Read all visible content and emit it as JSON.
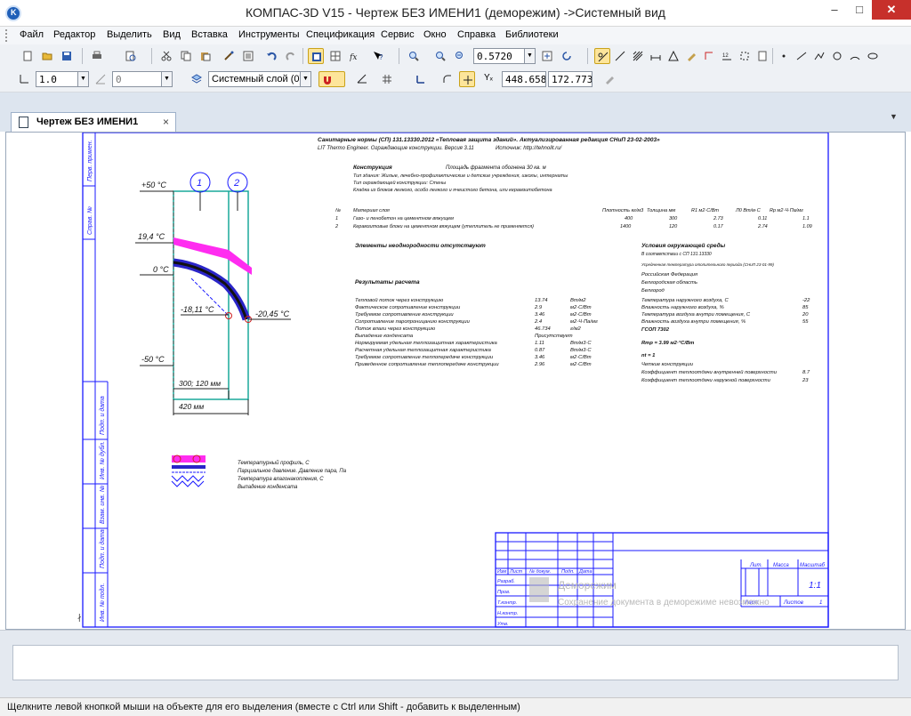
{
  "window": {
    "title": "КОМПАС-3D V15 - Чертеж БЕЗ ИМЕНИ1 (деморежим) ->Системный вид",
    "min_label": "–",
    "max_label": "□",
    "close_label": "✕"
  },
  "menu": [
    "Файл",
    "Редактор",
    "Выделить",
    "Вид",
    "Вставка",
    "Инструменты",
    "Спецификация",
    "Сервис",
    "Окно",
    "Справка",
    "Библиотеки"
  ],
  "toolbar": {
    "zoom_value": "0.5720",
    "line_width": "1.0",
    "angle_value": "0",
    "layer_value": "Системный слой (0)",
    "coord_x": "448.658",
    "coord_y": "172.773",
    "coord_label": "Yₓ"
  },
  "tab": {
    "label": "Чертеж БЕЗ ИМЕНИ1",
    "close": "×",
    "menu_arrow": "▼"
  },
  "drawing": {
    "header_line1": "Санитарные нормы (СП) 131.13330.2012 «Тепловая защита зданий». Актуализированная редакция СНиП 23-02-2003»",
    "header_line2": "LIT Thermo Engineer. Ограждающие конструкции. Версия 3.11",
    "header_line2_right": "Источник: http://tehnolit.ru/",
    "construction_label": "Конструкция",
    "construction_value": "Площадь фрагмента обогнена 30 кв. м",
    "construction_lines": [
      "Тип здания: Жилые, лечебно-профилактические и детские учреждения, школы, интернаты",
      "Тип ограждающей конструкции: Стены",
      "Кладка из блоков легкого, особо легкого и ячеистого бетона, или керамзитобетона"
    ],
    "table_headers": [
      "№",
      "Материал слоя",
      "Плотность кг/м3",
      "Толщина мм",
      "R1 м2·С/Вт",
      "Л0 Вт/м·С",
      "Rp м2·Ч·Па/мг"
    ],
    "table_rows": [
      [
        "1",
        "Газо- и пенобетон на цементном вяжущем",
        "400",
        "300",
        "2.73",
        "0.11",
        "1.1"
      ],
      [
        "2",
        "Керамзитовые блоки на цементном вяжущем (утеплитель не применяется)",
        "1400",
        "120",
        "0.17",
        "2.74",
        "1.09"
      ]
    ],
    "elements_heading": "Элементы неоднородности отсутствуют",
    "results_heading": "Результаты расчета",
    "results": [
      [
        "Тепловой поток через конструкцию",
        "13.74",
        "Вт/м2"
      ],
      [
        "Фактическое сопротивление конструкции",
        "2.9",
        "м2·С/Вт"
      ],
      [
        "Требуемое сопротивление конструкции",
        "3.46",
        "м2·С/Вт"
      ],
      [
        "Сопротивление паропроницанию конструкции",
        "2.4",
        "м2·Ч·Па/мг"
      ],
      [
        "Поток влаги через конструкцию",
        "46.734",
        "г/м2"
      ],
      [
        "Выпадение конденсата",
        "Присутствует",
        ""
      ],
      [
        "Нормируемая удельная теплозащитная характеристика",
        "1.11",
        "Вт/м3·С"
      ],
      [
        "Расчетная удельная теплозащитная характеристика",
        "0.87",
        "Вт/м3·С"
      ],
      [
        "Требуемое сопротивление теплопередаче конструкции",
        "3.46",
        "м2·С/Вт"
      ],
      [
        "Приведенное сопротивление теплопередаче конструкции",
        "2.96",
        "м2·С/Вт"
      ]
    ],
    "env_heading": "Условия окружающей среды",
    "env_lines": [
      "В соответствии с СП 131.13330",
      "Усредненная температура отопительного периода (СНиП 23-01-99)",
      "Российская Федерация",
      "Белгородская область",
      "Белгород"
    ],
    "env_values": [
      [
        "Температура наружного воздуха, С",
        "-22"
      ],
      [
        "Влажность наружного воздуха, %",
        "85"
      ],
      [
        "Температура воздуха внутри помещения, С",
        "20"
      ],
      [
        "Влажность воздуха внутри помещения, %",
        "55"
      ],
      [
        "ГСОП    7302",
        ""
      ],
      [
        "Rтр = 3.99 м2·°С/Вт",
        ""
      ],
      [
        "nt = 1",
        ""
      ],
      [
        "Четкие конструкции",
        ""
      ],
      [
        "Коэффициент теплоотдачи внутренней поверхности",
        "8.7"
      ],
      [
        "Коэффициент теплоотдачи наружной поверхности",
        "23"
      ]
    ],
    "layer1": "1",
    "layer2": "2",
    "t_plus50": "+50 °С",
    "t_19": "19,4 °С",
    "t_0": "0 °С",
    "t_minus18": "-18,11 °С",
    "t_minus20": "-20,45 °С",
    "t_minus50": "-50 °С",
    "dim_inner": "300; 120 мм",
    "dim_total": "420 мм",
    "legend": [
      "Температурный профиль, С",
      "Парциальное давление. Давление пара, Па",
      "Температура влагонакопления, С",
      "Выпадение конденсата"
    ],
    "side_labels": [
      "Перв. примен.",
      "Справ. №",
      "Подп. и дата",
      "Инв. № дубл.",
      "Взам. инв. №",
      "Подп. и дата",
      "Инв. № подл."
    ],
    "stamp_labels": [
      "Изм",
      "Лист",
      "№ докум.",
      "Подп.",
      "Дата",
      "Разраб.",
      "Пров.",
      "Т.контр.",
      "Н.контр.",
      "Утв."
    ],
    "stamp_lit": "Лит.",
    "stamp_mass": "Масса",
    "stamp_scale": "Масштаб",
    "stamp_scale_value": "1:1",
    "stamp_sheet": "Лист",
    "stamp_sheets": "Листов",
    "stamp_sheets_value": "1",
    "watermark1": "Деморежим",
    "watermark2": "Сохранение документа в деморежиме невозможно"
  },
  "status": "Щелкните левой кнопкой мыши на объекте для его выделения (вместе с Ctrl или Shift - добавить к выделенным)"
}
